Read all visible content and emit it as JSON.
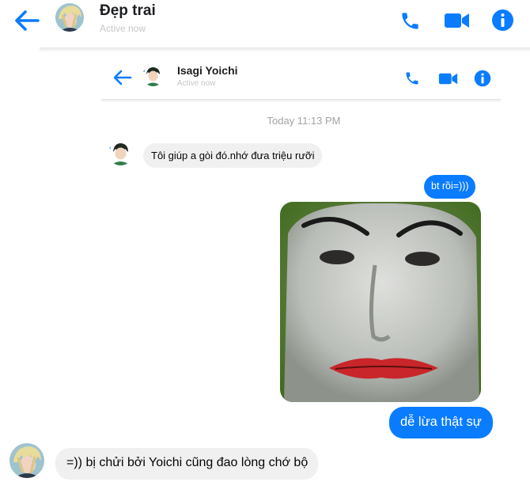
{
  "outer": {
    "contact_name": "Đẹp trai",
    "status": "Active now",
    "icons": [
      "back-arrow-icon",
      "phone-icon",
      "video-camera-icon",
      "info-icon"
    ]
  },
  "inner": {
    "contact_name": "Isagi Yoichi",
    "status": "Active now",
    "icons": [
      "back-arrow-icon",
      "phone-icon",
      "video-camera-icon",
      "info-icon"
    ]
  },
  "timestamp": "Today 11:13 PM",
  "messages": [
    {
      "from": "Isagi Yoichi",
      "text": "Tôi giúp a gòi đó.nhớ đưa triệu rưỡi"
    },
    {
      "from": "me",
      "text": "bt rồi=)))"
    },
    {
      "from": "me",
      "type": "image",
      "image": "meme-face-image"
    },
    {
      "from": "me",
      "text": "dễ lừa thật sự"
    },
    {
      "from": "Đẹp trai",
      "text": "=)) bị chửi bởi Yoichi cũng đao lòng chớ bộ"
    }
  ],
  "colors": {
    "accent": "#0a7cff",
    "incoming_bubble": "#f0f0f0",
    "status_text": "#c4c6c9"
  }
}
